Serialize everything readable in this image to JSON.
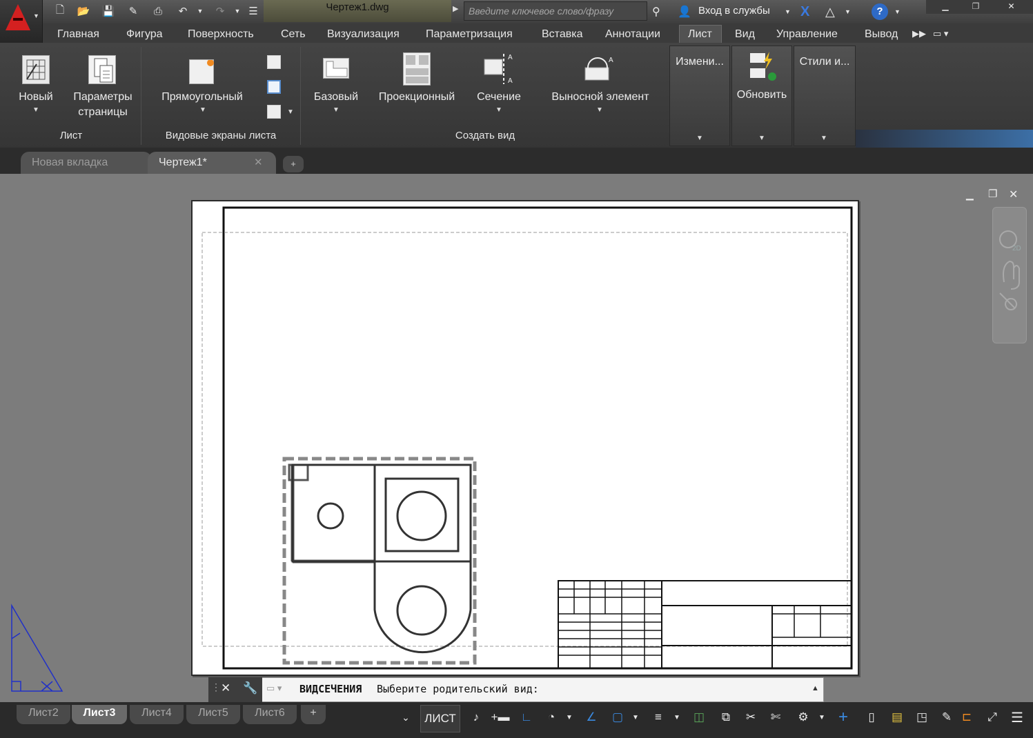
{
  "title_bar": {
    "document_title": "Чертеж1.dwg",
    "search_placeholder": "Введите ключевое слово/фразу",
    "login_label": "Вход в службы"
  },
  "menu": [
    "Главная",
    "Фигура",
    "Поверхность",
    "Сеть",
    "Визуализация",
    "Параметризация",
    "Вставка",
    "Аннотации",
    "Лист",
    "Вид",
    "Управление",
    "Вывод"
  ],
  "active_menu": "Лист",
  "ribbon": {
    "panel_sheet": {
      "title": "Лист",
      "new": "Новый",
      "page_params_1": "Параметры",
      "page_params_2": "страницы"
    },
    "panel_viewports": {
      "title": "Видовые экраны листа",
      "rect": "Прямоугольный"
    },
    "panel_create_view": {
      "title": "Создать вид",
      "base": "Базовый",
      "projected": "Проекционный",
      "section": "Сечение",
      "detail": "Выносной элемент"
    },
    "panel_modify": "Измени...",
    "panel_update": "Обновить",
    "panel_styles": "Стили и..."
  },
  "file_tabs": {
    "new_tab": "Новая вкладка",
    "drawing": "Чертеж1*"
  },
  "command_line": {
    "command": "ВИДСЕЧЕНИЯ",
    "prompt": "Выберите родительский вид:"
  },
  "layout_tabs": [
    "Лист2",
    "Лист3",
    "Лист4",
    "Лист5",
    "Лист6"
  ],
  "active_layout": "Лист3",
  "status": {
    "space": "ЛИСТ"
  },
  "colors": {
    "accent": "#2e6ac6",
    "logo": "#d42020",
    "ucs": "#2030c8"
  }
}
